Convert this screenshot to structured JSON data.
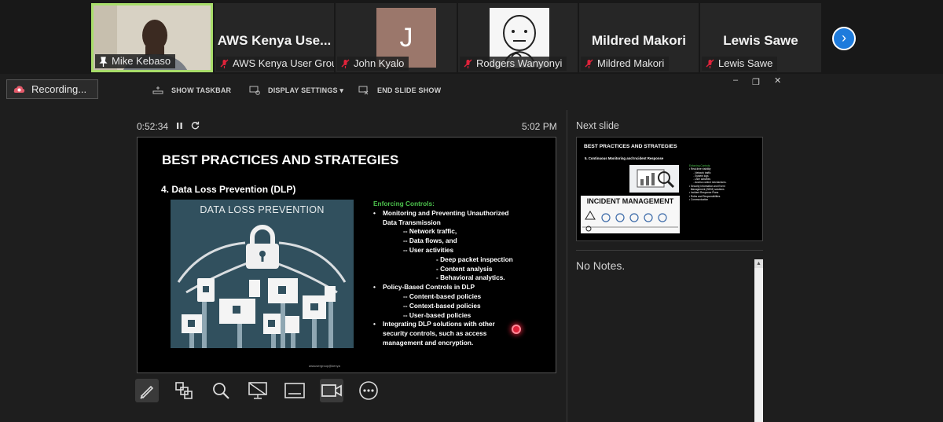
{
  "participants": [
    {
      "display_name": "",
      "label": "Mike Kebaso",
      "active": true
    },
    {
      "display_name": "AWS Kenya Use...",
      "label": "AWS Kenya User Group"
    },
    {
      "display_name": "",
      "avatar_letter": "J",
      "label": "John Kyalo"
    },
    {
      "display_name": "",
      "label": "Rodgers Wanyonyi"
    },
    {
      "display_name": "Mildred Makori",
      "label": "Mildred Makori"
    },
    {
      "display_name": "Lewis Sawe",
      "label": "Lewis Sawe"
    }
  ],
  "recording": {
    "label": "Recording..."
  },
  "presenter_toolbar": {
    "show_taskbar": "SHOW TASKBAR",
    "display_settings": "DISPLAY SETTINGS ▾",
    "end_slide_show": "END SLIDE SHOW"
  },
  "presenter": {
    "elapsed": "0:52:34",
    "clock": "5:02 PM",
    "next_slide_label": "Next slide",
    "notes": "No Notes."
  },
  "current_slide": {
    "title": "BEST PRACTICES AND STRATEGIES",
    "subtitle": "4. Data Loss Prevention (DLP)",
    "image_title": "DATA LOSS PREVENTION",
    "footer": "awsusergroup@kenya",
    "controls_heading": "Enforcing Controls:",
    "lines": [
      {
        "level": "b",
        "text": "Monitoring and Preventing Unauthorized"
      },
      {
        "level": "c",
        "text": "Data Transmission"
      },
      {
        "level": "l2",
        "text": "-- Network traffic,"
      },
      {
        "level": "l2",
        "text": "-- Data flows, and"
      },
      {
        "level": "l2",
        "text": "-- User activities"
      },
      {
        "level": "l3",
        "text": "- Deep packet inspection"
      },
      {
        "level": "l3",
        "text": "- Content analysis"
      },
      {
        "level": "l3",
        "text": "- Behavioral analytics."
      },
      {
        "level": "b",
        "text": "Policy-Based Controls in DLP"
      },
      {
        "level": "l2",
        "text": "-- Content-based policies"
      },
      {
        "level": "l2",
        "text": "-- Context-based policies"
      },
      {
        "level": "l2",
        "text": "-- User-based policies"
      },
      {
        "level": "b",
        "text": "Integrating DLP solutions with other"
      },
      {
        "level": "c",
        "text": "security controls, such as access"
      },
      {
        "level": "c",
        "text": "management and encryption."
      }
    ]
  },
  "next_slide": {
    "title": "BEST PRACTICES AND STRATEGIES",
    "subtitle": "5. Continuous Monitoring and Incident Response",
    "image_title": "INCIDENT MANAGEMENT",
    "list": [
      {
        "cls": "g",
        "text": "Enforcing Controls:"
      },
      {
        "cls": "",
        "text": "• Real-time visibility"
      },
      {
        "cls": "",
        "text": "      - Network traffic"
      },
      {
        "cls": "",
        "text": "      - System logs"
      },
      {
        "cls": "",
        "text": "      - User activities"
      },
      {
        "cls": "",
        "text": "      - Access control mechanisms."
      },
      {
        "cls": "",
        "text": "• Security Information and Event"
      },
      {
        "cls": "",
        "text": "  Management (SIEM) solutions"
      },
      {
        "cls": "",
        "text": "• Incident Response Plans"
      },
      {
        "cls": "",
        "text": "• Roles and Responsibilities"
      },
      {
        "cls": "",
        "text": "• Communication"
      }
    ]
  },
  "icons": [
    "pen-icon",
    "slides-grid-icon",
    "zoom-icon",
    "black-screen-icon",
    "subtitles-icon",
    "camera-icon",
    "more-icon"
  ],
  "colors": {
    "active_speaker": "#a8dd6a",
    "accent": "#1e7bdc",
    "slide_heading_green": "#4cc24c",
    "laser": "#e0223a"
  }
}
